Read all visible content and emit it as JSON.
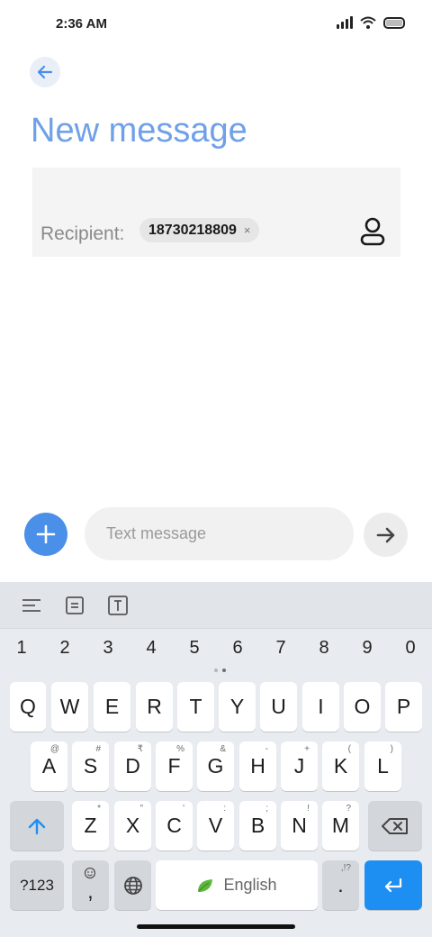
{
  "status_bar": {
    "time": "2:36 AM",
    "icons": [
      "signal-icon",
      "wifi-icon",
      "battery-icon"
    ]
  },
  "header": {
    "back_icon": "arrow-left-icon",
    "title": "New message"
  },
  "recipient": {
    "label": "Recipient:",
    "chip_number": "18730218809",
    "chip_close": "×",
    "contact_icon": "person-icon"
  },
  "compose": {
    "placeholder": "Text message",
    "add_icon": "plus-icon",
    "send_icon": "arrow-right-icon"
  },
  "keyboard": {
    "toolbar": [
      "align-icon",
      "clipboard-icon",
      "text-icon"
    ],
    "numbers": [
      "1",
      "2",
      "3",
      "4",
      "5",
      "6",
      "7",
      "8",
      "9",
      "0"
    ],
    "row1": [
      "Q",
      "W",
      "E",
      "R",
      "T",
      "Y",
      "U",
      "I",
      "O",
      "P"
    ],
    "row2": [
      {
        "l": "A",
        "h": "@"
      },
      {
        "l": "S",
        "h": "#"
      },
      {
        "l": "D",
        "h": "₹"
      },
      {
        "l": "F",
        "h": "%"
      },
      {
        "l": "G",
        "h": "&"
      },
      {
        "l": "H",
        "h": "-"
      },
      {
        "l": "J",
        "h": "+"
      },
      {
        "l": "K",
        "h": "("
      },
      {
        "l": "L",
        "h": ")"
      }
    ],
    "row3": [
      {
        "l": "Z",
        "h": "*"
      },
      {
        "l": "X",
        "h": "\""
      },
      {
        "l": "C",
        "h": "'"
      },
      {
        "l": "V",
        "h": ":"
      },
      {
        "l": "B",
        "h": ";"
      },
      {
        "l": "N",
        "h": "!"
      },
      {
        "l": "M",
        "h": "?"
      }
    ],
    "sym_label": "?123",
    "comma_label": ",",
    "space_label": "English",
    "period_label": ".",
    "period_hint": ",!?"
  },
  "colors": {
    "accent": "#4a8fe8",
    "title": "#6fa0e8",
    "enter_key": "#1e8ff2"
  }
}
